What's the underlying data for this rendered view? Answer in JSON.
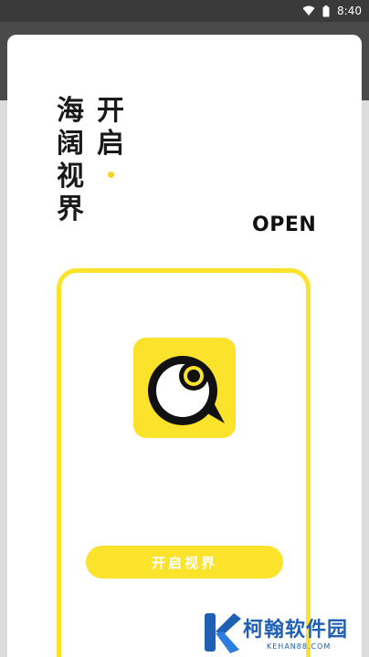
{
  "status_bar": {
    "time": "8:40",
    "icons": [
      "wifi-icon",
      "battery-icon"
    ]
  },
  "dialog": {
    "title_left_column": [
      "海",
      "阔",
      "视",
      "界"
    ],
    "title_right_column": [
      "开",
      "启"
    ],
    "open_label": "OPEN",
    "app_icon": "chat-bubble-eye-icon",
    "start_button_label": "开启视界"
  },
  "watermark": {
    "name": "柯翰软件园",
    "url": "KEHAN88.COM"
  },
  "colors": {
    "accent_yellow": "#fbe22b",
    "text_dark": "#1a1a1a",
    "watermark_blue": "#1f5fb4"
  }
}
